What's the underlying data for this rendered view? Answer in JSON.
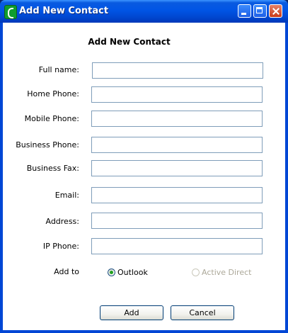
{
  "window": {
    "title": "Add New Contact",
    "minimize_label": "",
    "maximize_label": "",
    "close_label": ""
  },
  "form": {
    "heading": "Add New Contact",
    "fields": [
      {
        "label": "Full name:",
        "value": ""
      },
      {
        "label": "Home Phone:",
        "value": ""
      },
      {
        "label": "Mobile Phone:",
        "value": ""
      },
      {
        "label": "Business Phone:",
        "value": ""
      },
      {
        "label": "Business Fax:",
        "value": ""
      },
      {
        "label": "Email:",
        "value": ""
      },
      {
        "label": "Address:",
        "value": ""
      },
      {
        "label": "IP Phone:",
        "value": ""
      }
    ],
    "add_to": {
      "label": "Add to",
      "options": [
        {
          "label": "Outlook",
          "checked": true,
          "enabled": true
        },
        {
          "label": "Active Direct",
          "checked": false,
          "enabled": false
        }
      ]
    }
  },
  "buttons": {
    "add": "Add",
    "cancel": "Cancel"
  },
  "colors": {
    "titlebar": "#0055e5",
    "field_border": "#7f9db9",
    "button_border": "#003c74",
    "radio_checked": "#21a121",
    "disabled_text": "#aca899"
  },
  "icons": {
    "app": "phone-icon",
    "minimize": "minimize-icon",
    "maximize": "maximize-icon",
    "close": "close-icon"
  }
}
